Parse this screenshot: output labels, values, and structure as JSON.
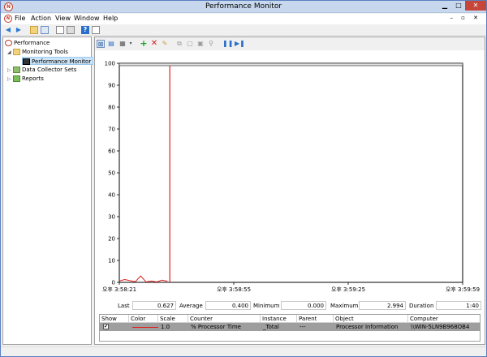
{
  "window": {
    "title": "Performance Monitor"
  },
  "menu": {
    "items": [
      "File",
      "Action",
      "View",
      "Window",
      "Help"
    ]
  },
  "tree": {
    "root": "Performance",
    "items": [
      {
        "label": "Monitoring Tools",
        "level": 1,
        "expanded": true
      },
      {
        "label": "Performance Monitor",
        "level": 2,
        "selected": true
      },
      {
        "label": "Data Collector Sets",
        "level": 1,
        "expanded": false
      },
      {
        "label": "Reports",
        "level": 1,
        "expanded": false
      }
    ]
  },
  "chart_data": {
    "type": "line",
    "ylim": [
      0,
      100
    ],
    "y_ticks": [
      "100",
      "90",
      "80",
      "70",
      "60",
      "50",
      "40",
      "30",
      "20",
      "10",
      "0"
    ],
    "x_ticks": [
      "오후 3:58:21",
      "오후 3:58:55",
      "오후 3:59:25",
      "오후 3:59:59"
    ],
    "grid": false,
    "series": [
      {
        "name": "% Processor Time",
        "color": "#e02020",
        "values": [
          0.6,
          1.3,
          0.8,
          0.3,
          2.9,
          0.2,
          0.6,
          0.2,
          1.0,
          0.5
        ]
      }
    ],
    "marker_line_color": "#e02020"
  },
  "stats": {
    "last_label": "Last",
    "last_value": "0.627",
    "average_label": "Average",
    "average_value": "0.400",
    "minimum_label": "Minimum",
    "minimum_value": "0.000",
    "maximum_label": "Maximum",
    "maximum_value": "2.994",
    "duration_label": "Duration",
    "duration_value": "1:40"
  },
  "counters": {
    "headers": [
      "Show",
      "Color",
      "Scale",
      "Counter",
      "Instance",
      "Parent",
      "Object",
      "Computer"
    ],
    "rows": [
      {
        "show": "✔",
        "scale": "1.0",
        "counter": "% Processor Time",
        "instance": "_Total",
        "parent": "---",
        "object": "Processor Information",
        "computer": "\\\\WIN-5LN9B968OB4"
      }
    ]
  },
  "colors": {
    "accent": "#c0392b",
    "line": "#e02020",
    "selection": "#9e9e9e"
  }
}
